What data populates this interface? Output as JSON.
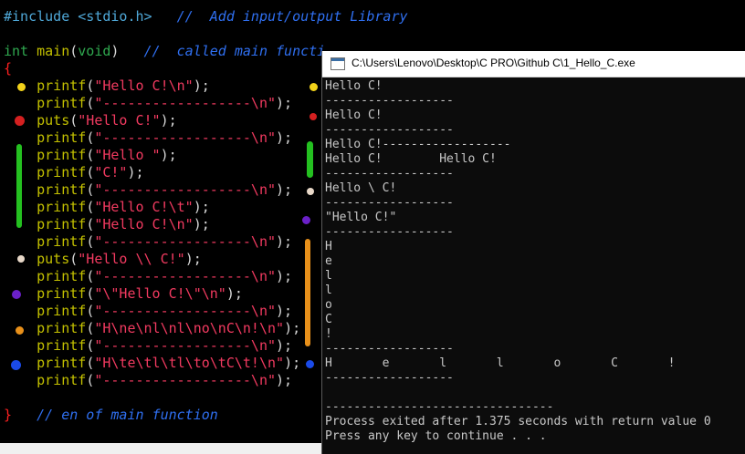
{
  "editor": {
    "lines": [
      {
        "segments": [
          {
            "c": "pp",
            "t": "#include <stdio.h>"
          },
          {
            "c": "plain",
            "t": "   "
          },
          {
            "c": "cmt",
            "t": "//  Add input/output Library"
          }
        ]
      },
      {
        "segments": []
      },
      {
        "segments": [
          {
            "c": "kw",
            "t": "int"
          },
          {
            "c": "plain",
            "t": " "
          },
          {
            "c": "fn",
            "t": "main"
          },
          {
            "c": "plain",
            "t": "("
          },
          {
            "c": "kw",
            "t": "void"
          },
          {
            "c": "plain",
            "t": ")   "
          },
          {
            "c": "cmt",
            "t": "//  called main functi"
          }
        ]
      },
      {
        "segments": [
          {
            "c": "brace",
            "t": "{"
          }
        ]
      },
      {
        "segments": [
          {
            "c": "plain",
            "t": "    "
          },
          {
            "c": "fn",
            "t": "printf"
          },
          {
            "c": "plain",
            "t": "("
          },
          {
            "c": "str",
            "t": "\"Hello C!\\n\""
          },
          {
            "c": "plain",
            "t": ");"
          }
        ]
      },
      {
        "segments": [
          {
            "c": "plain",
            "t": "    "
          },
          {
            "c": "fn",
            "t": "printf"
          },
          {
            "c": "plain",
            "t": "("
          },
          {
            "c": "str",
            "t": "\"------------------\\n\""
          },
          {
            "c": "plain",
            "t": ");"
          }
        ]
      },
      {
        "segments": [
          {
            "c": "plain",
            "t": "    "
          },
          {
            "c": "fn",
            "t": "puts"
          },
          {
            "c": "plain",
            "t": "("
          },
          {
            "c": "str",
            "t": "\"Hello C!\""
          },
          {
            "c": "plain",
            "t": ");"
          }
        ]
      },
      {
        "segments": [
          {
            "c": "plain",
            "t": "    "
          },
          {
            "c": "fn",
            "t": "printf"
          },
          {
            "c": "plain",
            "t": "("
          },
          {
            "c": "str",
            "t": "\"------------------\\n\""
          },
          {
            "c": "plain",
            "t": ");"
          }
        ]
      },
      {
        "segments": [
          {
            "c": "plain",
            "t": "    "
          },
          {
            "c": "fn",
            "t": "printf"
          },
          {
            "c": "plain",
            "t": "("
          },
          {
            "c": "str",
            "t": "\"Hello \""
          },
          {
            "c": "plain",
            "t": ");"
          }
        ]
      },
      {
        "segments": [
          {
            "c": "plain",
            "t": "    "
          },
          {
            "c": "fn",
            "t": "printf"
          },
          {
            "c": "plain",
            "t": "("
          },
          {
            "c": "str",
            "t": "\"C!\""
          },
          {
            "c": "plain",
            "t": ");"
          }
        ]
      },
      {
        "segments": [
          {
            "c": "plain",
            "t": "    "
          },
          {
            "c": "fn",
            "t": "printf"
          },
          {
            "c": "plain",
            "t": "("
          },
          {
            "c": "str",
            "t": "\"------------------\\n\""
          },
          {
            "c": "plain",
            "t": ");"
          }
        ]
      },
      {
        "segments": [
          {
            "c": "plain",
            "t": "    "
          },
          {
            "c": "fn",
            "t": "printf"
          },
          {
            "c": "plain",
            "t": "("
          },
          {
            "c": "str",
            "t": "\"Hello C!\\t\""
          },
          {
            "c": "plain",
            "t": ");"
          }
        ]
      },
      {
        "segments": [
          {
            "c": "plain",
            "t": "    "
          },
          {
            "c": "fn",
            "t": "printf"
          },
          {
            "c": "plain",
            "t": "("
          },
          {
            "c": "str",
            "t": "\"Hello C!\\n\""
          },
          {
            "c": "plain",
            "t": ");"
          }
        ]
      },
      {
        "segments": [
          {
            "c": "plain",
            "t": "    "
          },
          {
            "c": "fn",
            "t": "printf"
          },
          {
            "c": "plain",
            "t": "("
          },
          {
            "c": "str",
            "t": "\"------------------\\n\""
          },
          {
            "c": "plain",
            "t": ");"
          }
        ]
      },
      {
        "segments": [
          {
            "c": "plain",
            "t": "    "
          },
          {
            "c": "fn",
            "t": "puts"
          },
          {
            "c": "plain",
            "t": "("
          },
          {
            "c": "str",
            "t": "\"Hello \\\\ C!\""
          },
          {
            "c": "plain",
            "t": ");"
          }
        ]
      },
      {
        "segments": [
          {
            "c": "plain",
            "t": "    "
          },
          {
            "c": "fn",
            "t": "printf"
          },
          {
            "c": "plain",
            "t": "("
          },
          {
            "c": "str",
            "t": "\"------------------\\n\""
          },
          {
            "c": "plain",
            "t": ");"
          }
        ]
      },
      {
        "segments": [
          {
            "c": "plain",
            "t": "    "
          },
          {
            "c": "fn",
            "t": "printf"
          },
          {
            "c": "plain",
            "t": "("
          },
          {
            "c": "str",
            "t": "\"\\\"Hello C!\\\"\\n\""
          },
          {
            "c": "plain",
            "t": ");"
          }
        ]
      },
      {
        "segments": [
          {
            "c": "plain",
            "t": "    "
          },
          {
            "c": "fn",
            "t": "printf"
          },
          {
            "c": "plain",
            "t": "("
          },
          {
            "c": "str",
            "t": "\"------------------\\n\""
          },
          {
            "c": "plain",
            "t": ");"
          }
        ]
      },
      {
        "segments": [
          {
            "c": "plain",
            "t": "    "
          },
          {
            "c": "fn",
            "t": "printf"
          },
          {
            "c": "plain",
            "t": "("
          },
          {
            "c": "str",
            "t": "\"H\\ne\\nl\\nl\\no\\nC\\n!\\n\""
          },
          {
            "c": "plain",
            "t": ");"
          }
        ]
      },
      {
        "segments": [
          {
            "c": "plain",
            "t": "    "
          },
          {
            "c": "fn",
            "t": "printf"
          },
          {
            "c": "plain",
            "t": "("
          },
          {
            "c": "str",
            "t": "\"------------------\\n\""
          },
          {
            "c": "plain",
            "t": ");"
          }
        ]
      },
      {
        "segments": [
          {
            "c": "plain",
            "t": "    "
          },
          {
            "c": "fn",
            "t": "printf"
          },
          {
            "c": "plain",
            "t": "("
          },
          {
            "c": "str",
            "t": "\"H\\te\\tl\\tl\\to\\tC\\t!\\n\""
          },
          {
            "c": "plain",
            "t": ");"
          }
        ]
      },
      {
        "segments": [
          {
            "c": "plain",
            "t": "    "
          },
          {
            "c": "fn",
            "t": "printf"
          },
          {
            "c": "plain",
            "t": "("
          },
          {
            "c": "str",
            "t": "\"------------------\\n\""
          },
          {
            "c": "plain",
            "t": ");"
          }
        ]
      },
      {
        "segments": []
      },
      {
        "segments": [
          {
            "c": "brace",
            "t": "}"
          },
          {
            "c": "plain",
            "t": "   "
          },
          {
            "c": "cmt",
            "t": "// en of main function"
          }
        ]
      }
    ],
    "marker_colors": {
      "yellow": "#f2d21a",
      "red": "#d42020",
      "green": "#24c020",
      "white": "#e8d8c8",
      "purple": "#6a20c8",
      "orange": "#e8901a",
      "blue": "#1a4ae8"
    }
  },
  "console": {
    "title": "C:\\Users\\Lenovo\\Desktop\\C PRO\\Github C\\1_Hello_C.exe",
    "output": [
      "Hello C!",
      "------------------",
      "Hello C!",
      "------------------",
      "Hello C!------------------",
      "Hello C!        Hello C!",
      "------------------",
      "Hello \\ C!",
      "------------------",
      "\"Hello C!\"",
      "------------------",
      "H",
      "e",
      "l",
      "l",
      "o",
      "C",
      "!",
      "------------------",
      "H       e       l       l       o       C       !",
      "------------------",
      "",
      "--------------------------------",
      "Process exited after 1.375 seconds with return value 0",
      "Press any key to continue . . ."
    ]
  }
}
